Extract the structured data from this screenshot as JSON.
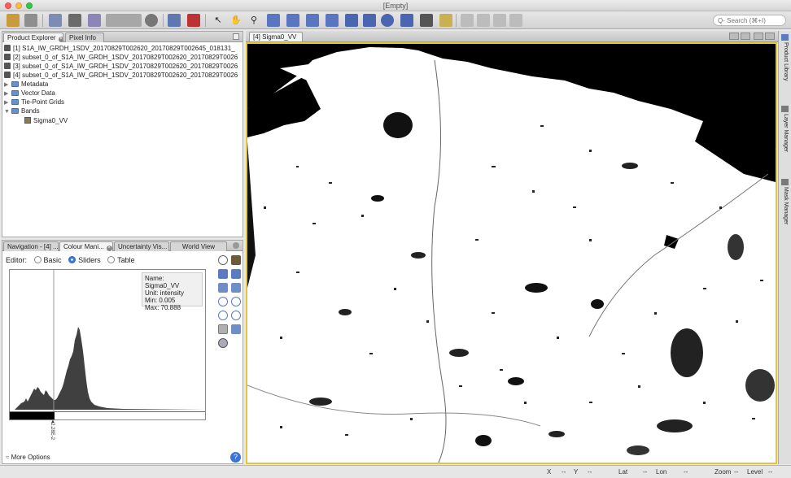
{
  "window": {
    "title": "[Empty]"
  },
  "toolbar": {
    "search_placeholder": "Q- Search (⌘+I)"
  },
  "left_top": {
    "tabs": [
      {
        "label": "Product Explorer"
      },
      {
        "label": "Pixel Info"
      }
    ],
    "products": [
      "[1] S1A_IW_GRDH_1SDV_20170829T002620_20170829T002645_018131_",
      "[2] subset_0_of_S1A_IW_GRDH_1SDV_20170829T002620_20170829T0026",
      "[3] subset_0_of_S1A_IW_GRDH_1SDV_20170829T002620_20170829T0026",
      "[4] subset_0_of_S1A_IW_GRDH_1SDV_20170829T002620_20170829T0026"
    ],
    "nodes": [
      "Metadata",
      "Vector Data",
      "Tie-Point Grids",
      "Bands"
    ],
    "band": "Sigma0_VV"
  },
  "left_bottom": {
    "tabs": [
      {
        "label": "Navigation - [4] ..."
      },
      {
        "label": "Colour Mani..."
      },
      {
        "label": "Uncertainty Vis..."
      },
      {
        "label": "World View"
      }
    ],
    "editor_label": "Editor:",
    "editor_options": [
      "Basic",
      "Sliders",
      "Table"
    ],
    "editor_selected": "Sliders",
    "info": {
      "name": "Name: Sigma0_VV",
      "unit": "Unit: intensity",
      "min": "Min: 0.005",
      "max": "Max: 70.888"
    },
    "slider_value": "2.28E-2",
    "more_options": "More Options"
  },
  "view": {
    "tab_label": "[4] Sigma0_VV"
  },
  "right_tools": [
    "Product Library",
    "Layer Manager",
    "Mask Manager"
  ],
  "status": {
    "x": "X",
    "x_val": "--",
    "y": "Y",
    "y_val": "--",
    "lat": "Lat",
    "lat_val": "--",
    "lon": "Lon",
    "lon_val": "--",
    "zoom": "Zoom",
    "zoom_val": "--",
    "level": "Level",
    "level_val": "--"
  },
  "colors": {
    "accent": "#2f7ae5",
    "view_border": "#e3c63a"
  }
}
